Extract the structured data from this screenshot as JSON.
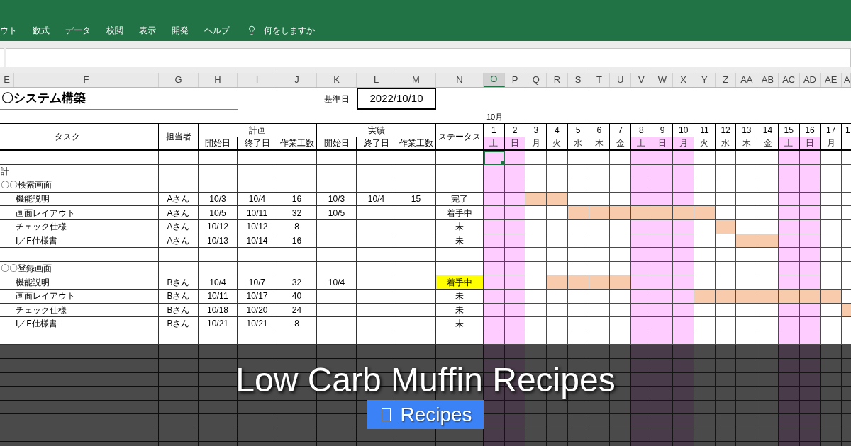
{
  "ribbon": {
    "tabs": [
      {
        "label": "ウト"
      },
      {
        "label": "数式"
      },
      {
        "label": "データ"
      },
      {
        "label": "校閲"
      },
      {
        "label": "表示"
      },
      {
        "label": "開発"
      },
      {
        "label": "ヘルプ"
      }
    ],
    "tell_me": "何をしますか"
  },
  "columns": [
    {
      "label": "E",
      "selected": false
    },
    {
      "label": "F",
      "selected": false
    },
    {
      "label": "G",
      "selected": false
    },
    {
      "label": "H",
      "selected": false
    },
    {
      "label": "I",
      "selected": false
    },
    {
      "label": "J",
      "selected": false
    },
    {
      "label": "K",
      "selected": false
    },
    {
      "label": "L",
      "selected": false
    },
    {
      "label": "M",
      "selected": false
    },
    {
      "label": "N",
      "selected": false
    },
    {
      "label": "O",
      "selected": true
    },
    {
      "label": "P",
      "selected": false
    },
    {
      "label": "Q",
      "selected": false
    },
    {
      "label": "R",
      "selected": false
    },
    {
      "label": "S",
      "selected": false
    },
    {
      "label": "T",
      "selected": false
    },
    {
      "label": "U",
      "selected": false
    },
    {
      "label": "V",
      "selected": false
    },
    {
      "label": "W",
      "selected": false
    },
    {
      "label": "X",
      "selected": false
    },
    {
      "label": "Y",
      "selected": false
    },
    {
      "label": "Z",
      "selected": false
    },
    {
      "label": "AA",
      "selected": false
    },
    {
      "label": "AB",
      "selected": false
    },
    {
      "label": "AC",
      "selected": false
    },
    {
      "label": "AD",
      "selected": false
    },
    {
      "label": "AE",
      "selected": false
    },
    {
      "label": "A",
      "selected": false
    }
  ],
  "sheet": {
    "title": "〇システム構築",
    "base_date_label": "基準日",
    "base_date": "2022/10/10",
    "month": "10月",
    "header": {
      "task": "タスク",
      "assignee": "担当者",
      "plan": {
        "label": "計画",
        "start": "開始日",
        "end": "終了日",
        "effort": "作業工数"
      },
      "actual": {
        "label": "実績",
        "start": "開始日",
        "end": "終了日",
        "effort": "作業工数"
      },
      "status": "ステータス"
    },
    "days": [
      {
        "day": "1",
        "weekday": "土",
        "holiday": true
      },
      {
        "day": "2",
        "weekday": "日",
        "holiday": true
      },
      {
        "day": "3",
        "weekday": "月",
        "holiday": false
      },
      {
        "day": "4",
        "weekday": "火",
        "holiday": false
      },
      {
        "day": "5",
        "weekday": "水",
        "holiday": false
      },
      {
        "day": "6",
        "weekday": "木",
        "holiday": false
      },
      {
        "day": "7",
        "weekday": "金",
        "holiday": false
      },
      {
        "day": "8",
        "weekday": "土",
        "holiday": true
      },
      {
        "day": "9",
        "weekday": "日",
        "holiday": true
      },
      {
        "day": "10",
        "weekday": "月",
        "holiday": true
      },
      {
        "day": "11",
        "weekday": "火",
        "holiday": false
      },
      {
        "day": "12",
        "weekday": "水",
        "holiday": false
      },
      {
        "day": "13",
        "weekday": "木",
        "holiday": false
      },
      {
        "day": "14",
        "weekday": "金",
        "holiday": false
      },
      {
        "day": "15",
        "weekday": "土",
        "holiday": true
      },
      {
        "day": "16",
        "weekday": "日",
        "holiday": true
      },
      {
        "day": "17",
        "weekday": "月",
        "holiday": false
      },
      {
        "day": "1",
        "holiday": false
      }
    ],
    "rows": [
      {
        "kind": "blank",
        "selected": true
      },
      {
        "kind": "section",
        "task": "計",
        "selected": false
      },
      {
        "kind": "section",
        "task": "〇〇検索画面",
        "selected": false,
        "children": [
          {
            "kind": "task",
            "task": "機能説明",
            "assignee": "Aさん",
            "plan_start": "10/3",
            "plan_end": "10/4",
            "plan_effort": "16",
            "actual_start": "10/3",
            "actual_end": "10/4",
            "actual_effort": "15",
            "status": "完了",
            "status_highlighted": false,
            "selected": false,
            "gantt": [
              false,
              false,
              true,
              true,
              false,
              false,
              false,
              false,
              false,
              false,
              false,
              false,
              false,
              false,
              false,
              false,
              false,
              false
            ]
          },
          {
            "kind": "task",
            "task": "画面レイアウト",
            "assignee": "Aさん",
            "plan_start": "10/5",
            "plan_end": "10/11",
            "plan_effort": "32",
            "actual_start": "10/5",
            "status": "着手中",
            "status_highlighted": false,
            "selected": false,
            "gantt": [
              false,
              false,
              false,
              false,
              true,
              true,
              true,
              true,
              true,
              true,
              true,
              false,
              false,
              false,
              false,
              false,
              false,
              false
            ]
          },
          {
            "kind": "task",
            "task": "チェック仕様",
            "assignee": "Aさん",
            "plan_start": "10/12",
            "plan_end": "10/12",
            "plan_effort": "8",
            "status": "未",
            "status_highlighted": false,
            "selected": false,
            "gantt": [
              false,
              false,
              false,
              false,
              false,
              false,
              false,
              false,
              false,
              false,
              false,
              true,
              false,
              false,
              false,
              false,
              false,
              false
            ]
          },
          {
            "kind": "task",
            "task": "I／F仕様書",
            "assignee": "Aさん",
            "plan_start": "10/13",
            "plan_end": "10/14",
            "plan_effort": "16",
            "status": "未",
            "status_highlighted": false,
            "selected": false,
            "gantt": [
              false,
              false,
              false,
              false,
              false,
              false,
              false,
              false,
              false,
              false,
              false,
              false,
              true,
              true,
              false,
              false,
              false,
              false
            ]
          }
        ]
      },
      {
        "kind": "blank",
        "selected": false
      },
      {
        "kind": "section",
        "task": "〇〇登録画面",
        "selected": false,
        "children": [
          {
            "kind": "task",
            "task": "機能説明",
            "assignee": "Bさん",
            "plan_start": "10/4",
            "plan_end": "10/7",
            "plan_effort": "32",
            "actual_start": "10/4",
            "status": "着手中",
            "status_highlighted": true,
            "selected": false,
            "gantt": [
              false,
              false,
              false,
              true,
              true,
              true,
              true,
              false,
              false,
              false,
              false,
              false,
              false,
              false,
              false,
              false,
              false,
              false
            ]
          },
          {
            "kind": "task",
            "task": "画面レイアウト",
            "assignee": "Bさん",
            "plan_start": "10/11",
            "plan_end": "10/17",
            "plan_effort": "40",
            "status": "未",
            "status_highlighted": false,
            "selected": false,
            "gantt": [
              false,
              false,
              false,
              false,
              false,
              false,
              false,
              false,
              false,
              false,
              true,
              true,
              true,
              true,
              true,
              true,
              true,
              false
            ]
          },
          {
            "kind": "task",
            "task": "チェック仕様",
            "assignee": "Bさん",
            "plan_start": "10/18",
            "plan_end": "10/20",
            "plan_effort": "24",
            "status": "未",
            "status_highlighted": false,
            "selected": false,
            "gantt": [
              false,
              false,
              false,
              false,
              false,
              false,
              false,
              false,
              false,
              false,
              false,
              false,
              false,
              false,
              false,
              false,
              false,
              true
            ]
          },
          {
            "kind": "task",
            "task": "I／F仕様書",
            "assignee": "Bさん",
            "plan_start": "10/21",
            "plan_end": "10/21",
            "plan_effort": "8",
            "status": "未",
            "status_highlighted": false,
            "selected": false,
            "gantt": [
              false,
              false,
              false,
              false,
              false,
              false,
              false,
              false,
              false,
              false,
              false,
              false,
              false,
              false,
              false,
              false,
              false,
              false
            ]
          }
        ]
      },
      {
        "kind": "blank",
        "selected": false
      },
      {
        "kind": "blank",
        "selected": false
      },
      {
        "kind": "blank",
        "selected": false
      },
      {
        "kind": "blank",
        "selected": false
      },
      {
        "kind": "blank",
        "selected": false
      },
      {
        "kind": "blank",
        "selected": false
      },
      {
        "kind": "blank",
        "selected": false
      },
      {
        "kind": "blank",
        "selected": false
      },
      {
        "kind": "blank",
        "selected": false
      }
    ]
  },
  "banner": {
    "title": "Low Carb Muffin Recipes",
    "badge": "Recipes"
  }
}
